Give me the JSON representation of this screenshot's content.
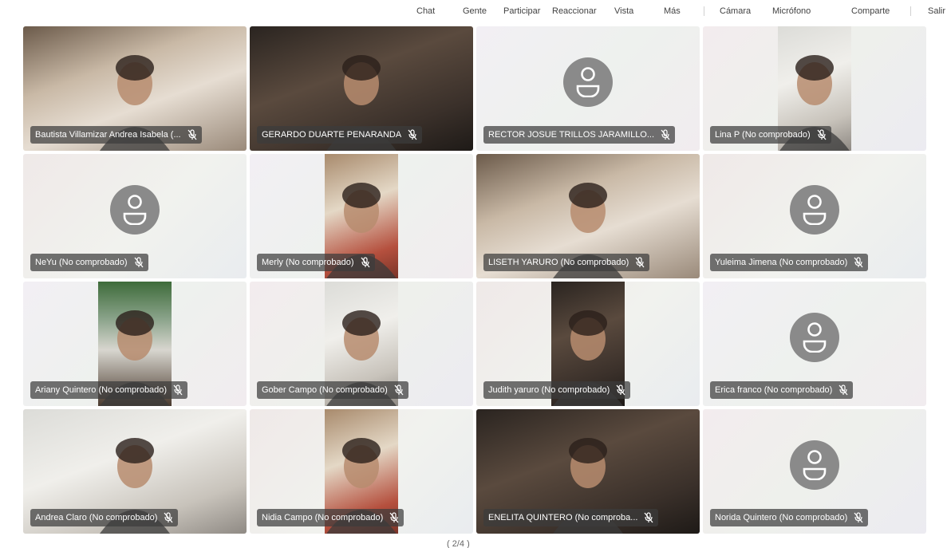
{
  "toolbar": {
    "items": [
      "Chat",
      "Gente",
      "Participar",
      "Reaccionar",
      "Vista",
      "Más",
      "Cámara",
      "Micrófono",
      "Comparte",
      "Salir"
    ]
  },
  "participants": [
    {
      "name": "Bautista Villamizar Andrea Isabela (...",
      "video": "full",
      "tone": "room"
    },
    {
      "name": "GERARDO DUARTE PENARANDA",
      "video": "full",
      "tone": "dark"
    },
    {
      "name": "RECTOR JOSUE TRILLOS JARAMILLO...",
      "video": "none"
    },
    {
      "name": "Lina P (No comprobado)",
      "video": "narrow",
      "tone": "light"
    },
    {
      "name": "NeYu (No comprobado)",
      "video": "none"
    },
    {
      "name": "Merly (No comprobado)",
      "video": "narrow",
      "tone": "warm"
    },
    {
      "name": "LISETH YARURO (No comprobado)",
      "video": "full",
      "tone": "room"
    },
    {
      "name": "Yuleima Jimena (No comprobado)",
      "video": "none"
    },
    {
      "name": "Ariany Quintero (No comprobado)",
      "video": "narrow",
      "tone": "green"
    },
    {
      "name": "Gober Campo (No comprobado)",
      "video": "narrow",
      "tone": "light"
    },
    {
      "name": "Judith yaruro (No comprobado)",
      "video": "narrow",
      "tone": "dark"
    },
    {
      "name": "Erica franco (No comprobado)",
      "video": "none"
    },
    {
      "name": "Andrea Claro (No comprobado)",
      "video": "full",
      "tone": "light"
    },
    {
      "name": "Nidia Campo (No comprobado)",
      "video": "narrow",
      "tone": "warm"
    },
    {
      "name": "ENELITA QUINTERO (No comproba...",
      "video": "full",
      "tone": "dark"
    },
    {
      "name": "Norida Quintero (No comprobado)",
      "video": "none"
    }
  ],
  "pager": {
    "label": "( 2/4 )"
  },
  "colors": {
    "avatar": "#8a8a8a",
    "namebar": "#3c3c3c",
    "toolbar_text": "#424242"
  },
  "icons": {
    "avatar": "person-icon",
    "mic": "mic-muted-icon"
  }
}
